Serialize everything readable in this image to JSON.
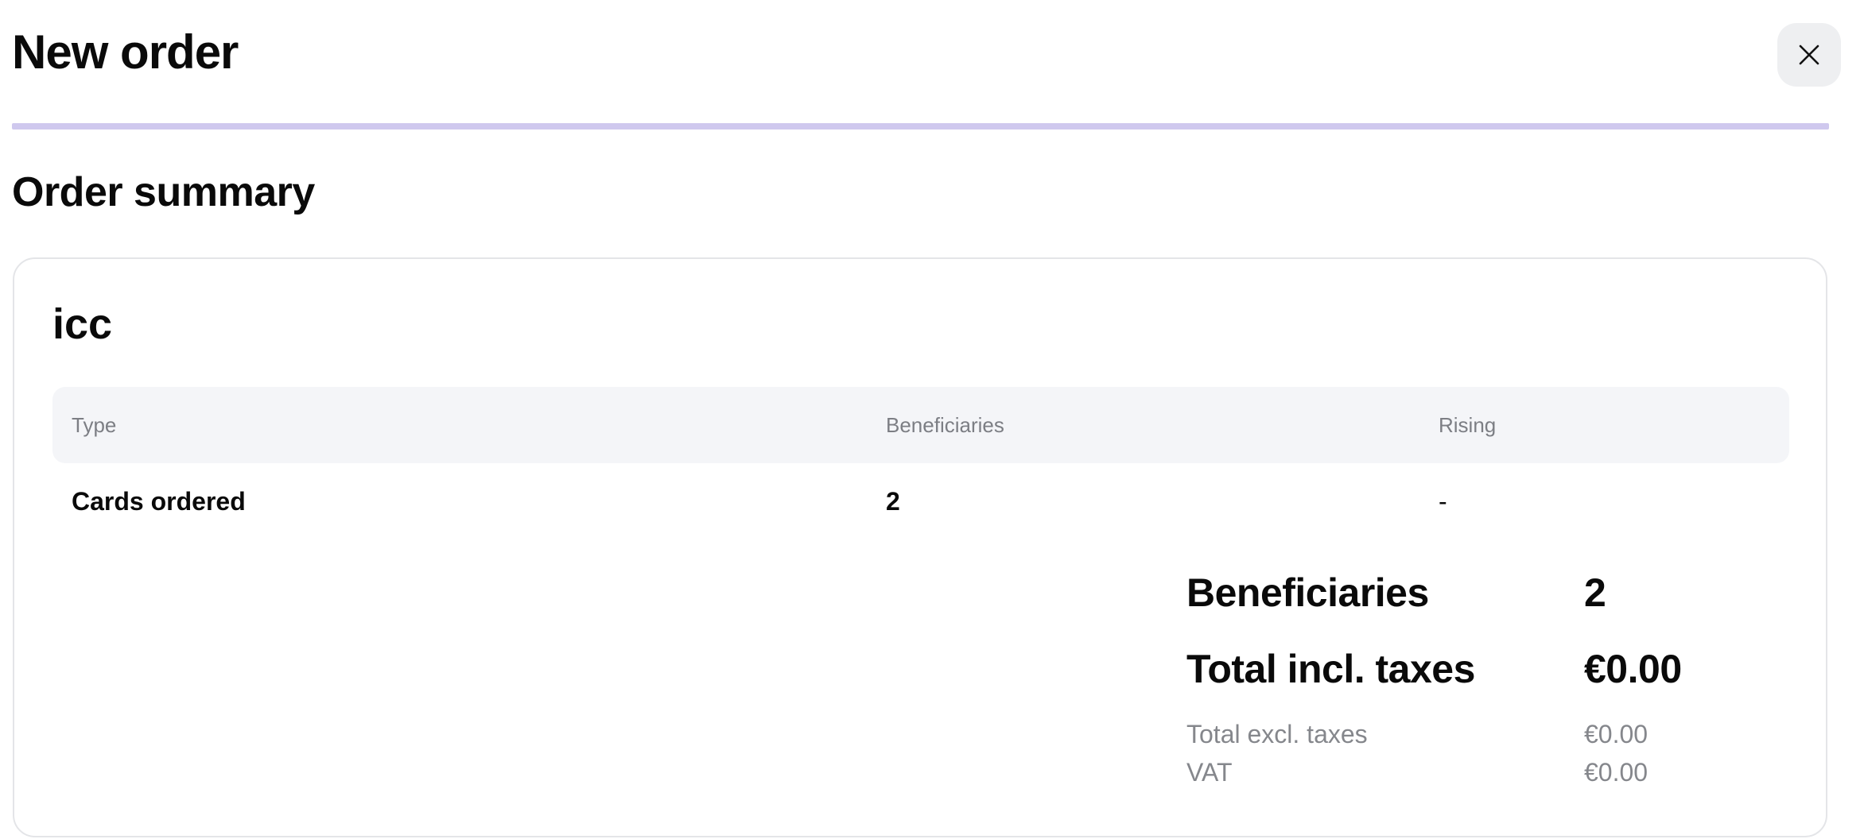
{
  "header": {
    "title": "New order",
    "close_icon": "close-icon"
  },
  "progress": {
    "fraction": 1.0,
    "color": "#cfc8ee"
  },
  "order_summary": {
    "title": "Order summary",
    "card": {
      "title": "icc",
      "table": {
        "columns": [
          "Type",
          "Beneficiaries",
          "Rising"
        ],
        "rows": [
          [
            "Cards ordered",
            "2",
            "-"
          ]
        ]
      },
      "totals": {
        "beneficiaries_label": "Beneficiaries",
        "beneficiaries_value": "2",
        "total_incl_label": "Total incl. taxes",
        "total_incl_value": "€0.00",
        "total_excl_label": "Total excl. taxes",
        "total_excl_value": "€0.00",
        "vat_label": "VAT",
        "vat_value": "€0.00"
      }
    }
  }
}
